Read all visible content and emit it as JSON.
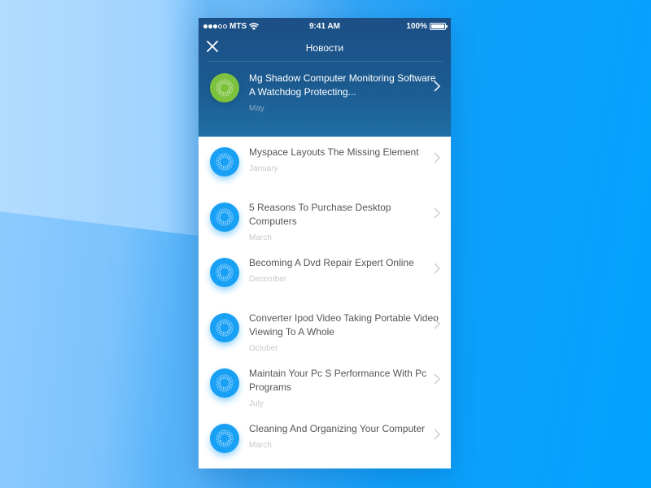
{
  "status_bar": {
    "carrier": "MTS",
    "signal_bars_filled": 3,
    "signal_bars_total": 5,
    "time": "9:41 AM",
    "battery": "100%"
  },
  "nav": {
    "title": "Новости",
    "close_icon": "close-icon"
  },
  "featured": {
    "title": "Mg Shadow Computer Monitoring Software A Watchdog Protecting...",
    "date": "May",
    "icon": "sunburst-icon",
    "color": "#7cc23e"
  },
  "news": [
    {
      "title": "Myspace Layouts The Missing Element",
      "date": "January"
    },
    {
      "title": "5 Reasons To Purchase Desktop Computers",
      "date": "March"
    },
    {
      "title": "Becoming A Dvd Repair Expert Online",
      "date": "December"
    },
    {
      "title": "Converter Ipod Video Taking Portable Video Viewing To A Whole",
      "date": "October"
    },
    {
      "title": "Maintain Your Pc S Performance With Pc Programs",
      "date": "July"
    },
    {
      "title": "Cleaning And Organizing Your Computer",
      "date": "March"
    }
  ],
  "colors": {
    "header": "#1b5a8f",
    "accent_blue": "#18a0f5",
    "accent_green": "#7cc23e"
  }
}
